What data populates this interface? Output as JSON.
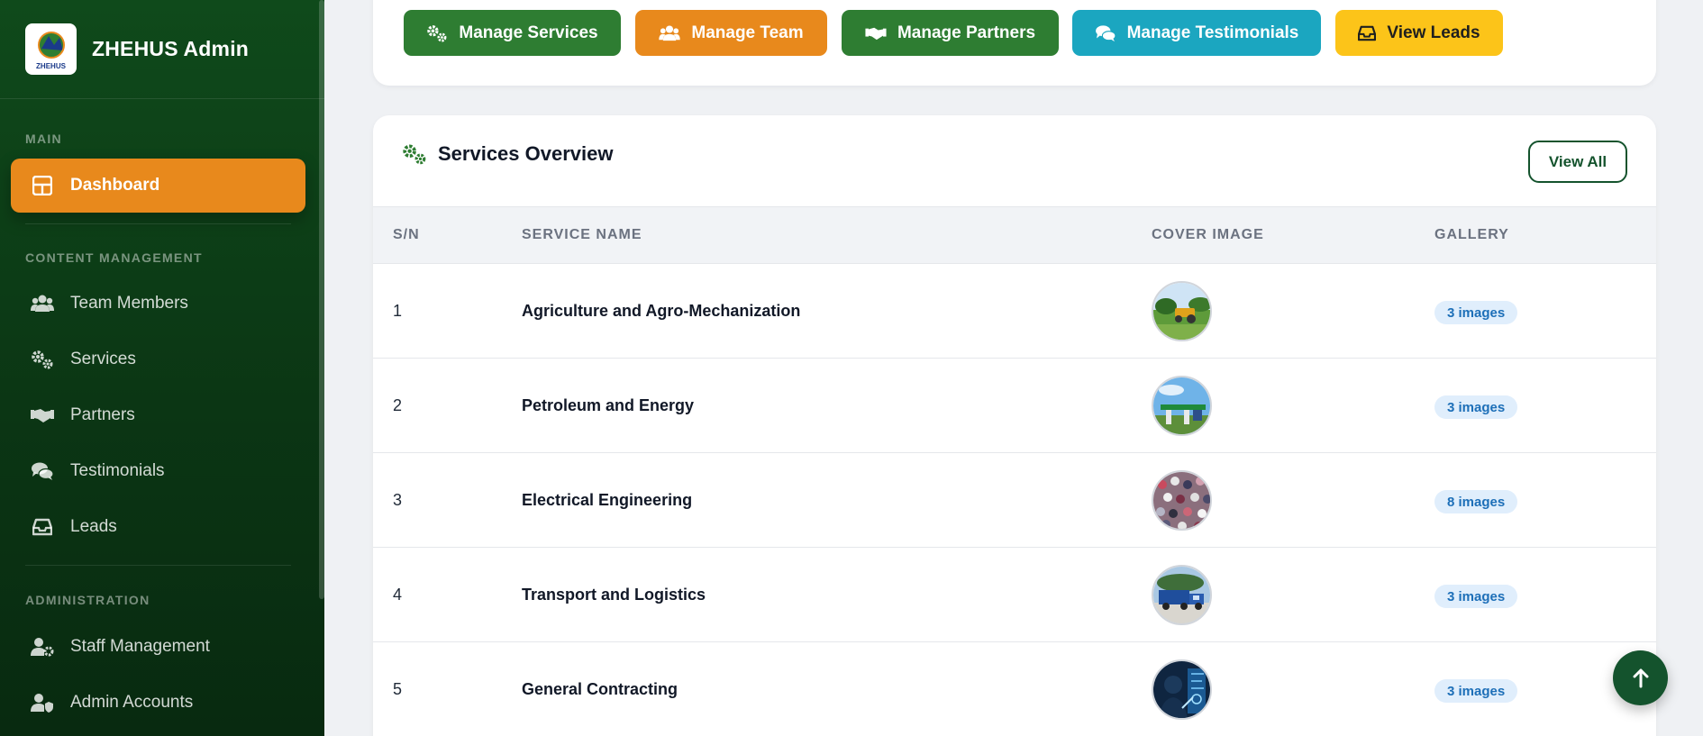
{
  "brand": {
    "name": "ZHEHUS Admin",
    "logo_text": "ZHEHUS"
  },
  "sidebar": {
    "sections": {
      "main": "MAIN",
      "content": "CONTENT MANAGEMENT",
      "admin": "ADMINISTRATION"
    },
    "items": [
      {
        "label": "Dashboard",
        "icon": "dashboard-icon",
        "active": true
      },
      {
        "label": "Team Members",
        "icon": "users-icon"
      },
      {
        "label": "Services",
        "icon": "gears-icon"
      },
      {
        "label": "Partners",
        "icon": "handshake-icon"
      },
      {
        "label": "Testimonials",
        "icon": "comments-icon"
      },
      {
        "label": "Leads",
        "icon": "inbox-icon"
      },
      {
        "label": "Staff Management",
        "icon": "user-cog-icon"
      },
      {
        "label": "Admin Accounts",
        "icon": "user-shield-icon"
      }
    ]
  },
  "quick_actions": [
    {
      "label": "Manage Services",
      "icon": "gears-icon",
      "color": "#2e7d32"
    },
    {
      "label": "Manage Team",
      "icon": "users-icon",
      "color": "#e8891c"
    },
    {
      "label": "Manage Partners",
      "icon": "handshake-icon",
      "color": "#2e7d32"
    },
    {
      "label": "Manage Testimonials",
      "icon": "comments-icon",
      "color": "#1ba6c0"
    },
    {
      "label": "View Leads",
      "icon": "inbox-icon",
      "color": "#fcc419"
    }
  ],
  "services_panel": {
    "title": "Services Overview",
    "view_all": "View All",
    "columns": [
      "S/N",
      "SERVICE NAME",
      "COVER IMAGE",
      "GALLERY"
    ],
    "rows": [
      {
        "sn": "1",
        "name": "Agriculture and Agro-Mechanization",
        "gallery": "3 images"
      },
      {
        "sn": "2",
        "name": "Petroleum and Energy",
        "gallery": "3 images"
      },
      {
        "sn": "3",
        "name": "Electrical Engineering",
        "gallery": "8 images"
      },
      {
        "sn": "4",
        "name": "Transport and Logistics",
        "gallery": "3 images"
      },
      {
        "sn": "5",
        "name": "General Contracting",
        "gallery": "3 images"
      }
    ]
  },
  "colors": {
    "sidebar": "#0f4a1b",
    "accent": "#e8891c",
    "primary": "#14532d"
  }
}
